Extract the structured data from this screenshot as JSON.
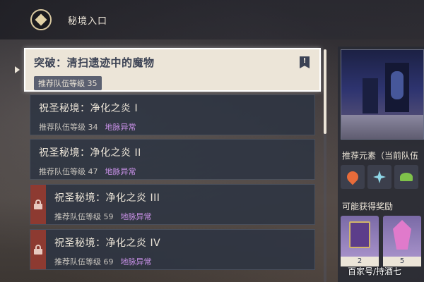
{
  "header": {
    "title": "秘境入口"
  },
  "domains": [
    {
      "title": "突破：清扫遗迹中的魔物",
      "level": "推荐队伍等级 35",
      "badge": "",
      "locked": false,
      "selected": true
    },
    {
      "title": "祝圣秘境：净化之炎 I",
      "level": "推荐队伍等级 34",
      "badge": "地脉异常",
      "locked": false,
      "selected": false
    },
    {
      "title": "祝圣秘境：净化之炎 II",
      "level": "推荐队伍等级 47",
      "badge": "地脉异常",
      "locked": false,
      "selected": false
    },
    {
      "title": "祝圣秘境：净化之炎 III",
      "level": "推荐队伍等级 59",
      "badge": "地脉异常",
      "locked": true,
      "selected": false
    },
    {
      "title": "祝圣秘境：净化之炎 IV",
      "level": "推荐队伍等级 69",
      "badge": "地脉异常",
      "locked": true,
      "selected": false
    }
  ],
  "side_panel": {
    "recommended_elements_label": "推荐元素（当前队伍",
    "elements": [
      "pyro-icon",
      "cryo-icon",
      "dendro-icon"
    ],
    "rewards_label": "可能获得奖励",
    "rewards": [
      {
        "icon": "book-icon",
        "count": "2"
      },
      {
        "icon": "crystal-icon",
        "count": "5"
      }
    ]
  },
  "watermark": "百家号/持酒七",
  "colors": {
    "selected_card": "#ece5d8",
    "card": "#2e3442",
    "lock_strip": "#8d3a31",
    "badge": "#c991e8"
  }
}
